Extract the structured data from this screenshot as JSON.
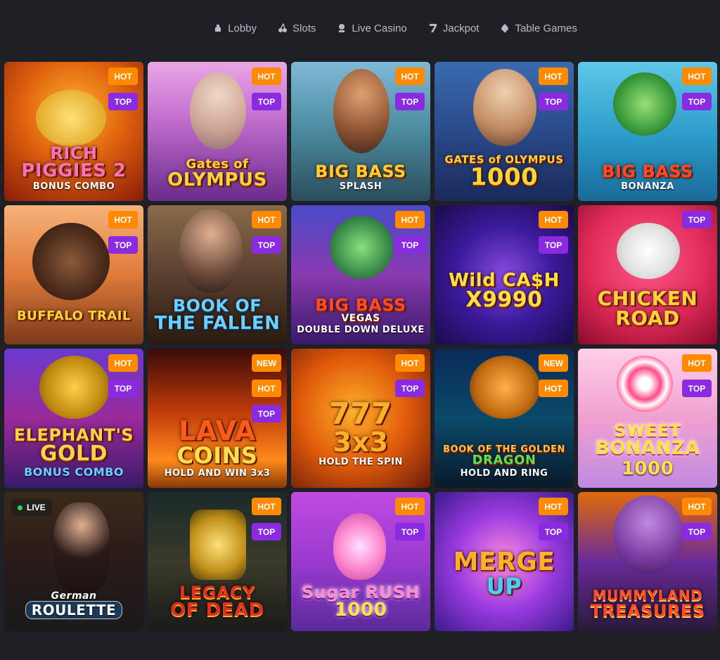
{
  "nav": [
    {
      "label": "Lobby",
      "icon": "chip-icon"
    },
    {
      "label": "Slots",
      "icon": "cherry-icon"
    },
    {
      "label": "Live Casino",
      "icon": "dealer-icon"
    },
    {
      "label": "Jackpot",
      "icon": "seven-icon"
    },
    {
      "label": "Table Games",
      "icon": "spade-icon"
    }
  ],
  "badges": {
    "hot": "HOT",
    "top": "TOP",
    "new": "NEW",
    "live": "LIVE"
  },
  "games": [
    {
      "l1": "RICH",
      "l2": "PIGGIES 2",
      "l3": "BONUS COMBO"
    },
    {
      "l1": "Gates of",
      "l2": "OLYMPUS",
      "l3": ""
    },
    {
      "l1": "BIG BASS",
      "l2": "",
      "l3": "SPLASH"
    },
    {
      "l1": "GATES of OLYMPUS",
      "l2": "1000",
      "l3": ""
    },
    {
      "l1": "BIG BASS",
      "l2": "",
      "l3": "BONANZA"
    },
    {
      "l1": "",
      "l2": "BUFFALO TRAIL",
      "l3": ""
    },
    {
      "l1": "BOOK OF",
      "l2": "THE FALLEN",
      "l3": ""
    },
    {
      "l1": "BIG BASS",
      "l2": "VEGAS",
      "l3": "DOUBLE DOWN DELUXE"
    },
    {
      "l1": "Wild CA$H",
      "l2": "X9990",
      "l3": ""
    },
    {
      "l1": "CHICKEN",
      "l2": "ROAD",
      "l3": ""
    },
    {
      "l1": "ELEPHANT'S",
      "l2": "GOLD",
      "l3": "BONUS COMBO"
    },
    {
      "l1": "LAVA",
      "l2": "COINS",
      "l3": "HOLD AND WIN 3x3"
    },
    {
      "l1": "777",
      "l2": "3x3",
      "l3": "HOLD THE SPIN"
    },
    {
      "l1": "BOOK OF THE GOLDEN",
      "l2": "DRAGON",
      "l3": "HOLD AND RING"
    },
    {
      "l1": "SWEET",
      "l2": "BONANZA",
      "l3": "1000"
    },
    {
      "l1": "German",
      "l2": "ROULETTE",
      "l3": ""
    },
    {
      "l1": "LEGACY",
      "l2": "OF DEAD",
      "l3": ""
    },
    {
      "l1": "Sugar RUSH",
      "l2": "1000",
      "l3": ""
    },
    {
      "l1": "MERGE",
      "l2": "UP",
      "l3": ""
    },
    {
      "l1": "MUMMYLAND",
      "l2": "TREASURES",
      "l3": ""
    }
  ]
}
